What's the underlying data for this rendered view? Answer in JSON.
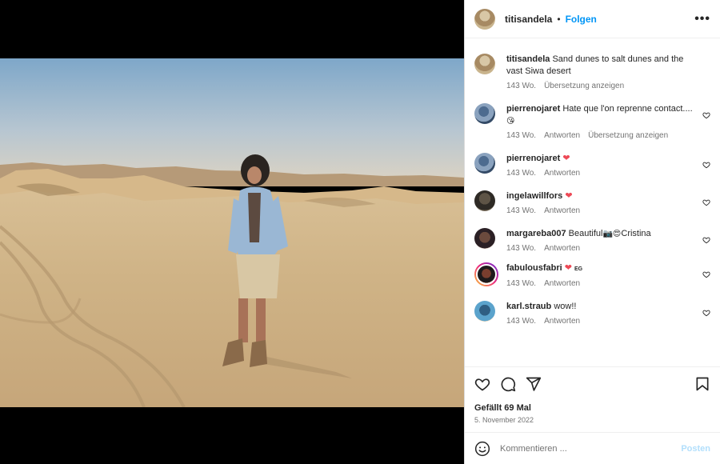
{
  "post": {
    "author": "titisandela",
    "follow_label": "Folgen",
    "separator": "•",
    "more_label": "•••",
    "caption_user": "titisandela",
    "caption_text": "Sand dunes to salt dunes and the vast Siwa desert",
    "caption_age": "143 Wo.",
    "caption_translate": "Übersetzung anzeigen",
    "likes": "Gefällt 69 Mal",
    "date": "5. November 2022"
  },
  "comments": [
    {
      "user": "pierrenojaret",
      "text": "Hate que l'on reprenne contact....",
      "emoji": "😘",
      "age": "143 Wo.",
      "reply": "Antworten",
      "translate": "Übersetzung anzeigen"
    },
    {
      "user": "pierrenojaret",
      "text": "",
      "emoji": "❤",
      "age": "143 Wo.",
      "reply": "Antworten"
    },
    {
      "user": "ingelawillfors",
      "text": "",
      "emoji": "❤",
      "age": "143 Wo.",
      "reply": "Antworten"
    },
    {
      "user": "margareba007",
      "text": "Beautiful",
      "emoji": "📷😍",
      "text2": "Cristina",
      "age": "143 Wo.",
      "reply": "Antworten"
    },
    {
      "user": "fabulousfabri",
      "text": "",
      "emoji": "❤",
      "tag": "EG",
      "age": "143 Wo.",
      "reply": "Antworten"
    },
    {
      "user": "karl.straub",
      "text": "wow!!",
      "age": "143 Wo.",
      "reply": "Antworten"
    }
  ],
  "composer": {
    "placeholder": "Kommentieren ...",
    "post_label": "Posten"
  },
  "colors": {
    "accent": "#0095f6",
    "like_red": "#ed4956",
    "post_disabled": "#b2dffc"
  }
}
